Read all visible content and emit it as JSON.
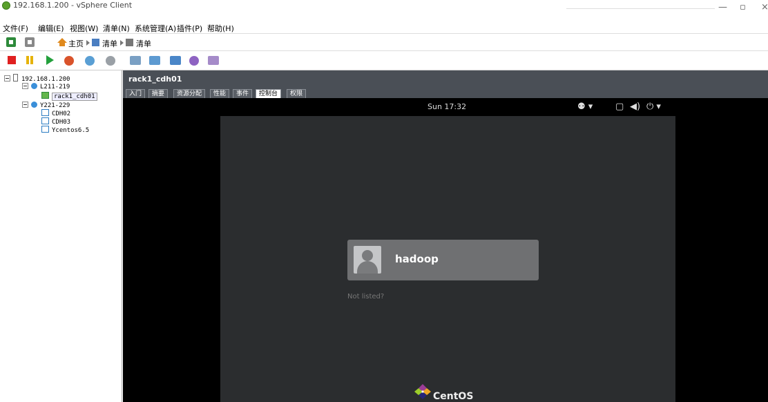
{
  "window": {
    "title": "192.168.1.200 - vSphere Client",
    "min": "—",
    "max": "▫",
    "close": "×"
  },
  "menu": [
    "文件(F)",
    "编辑(E)",
    "视图(W)",
    "清单(N)",
    "系统管理(A)",
    "插件(P)",
    "帮助(H)"
  ],
  "nav": {
    "home": "主页",
    "crumb1": "清单",
    "crumb2": "清单"
  },
  "tree": {
    "root": "192.168.1.200",
    "group1": "L211-219",
    "vm1": "rack1_cdh01",
    "group2": "Y221-229",
    "vm2": "CDH02",
    "vm3": "CDH03",
    "vm4": "Ycentos6.5"
  },
  "vm": {
    "title": "rack1_cdh01",
    "tabs": [
      "入门",
      "摘要",
      "资源分配",
      "性能",
      "事件",
      "控制台",
      "权限"
    ],
    "active_tab": "控制台"
  },
  "console": {
    "clock": "Sun 17:32",
    "user": "hadoop",
    "not_listed": "Not listed?",
    "brand": "CentOS",
    "icons": {
      "accessibility": "accessibility-icon",
      "window": "window-icon",
      "volume": "volume-icon",
      "power": "power-icon"
    }
  },
  "colors": {
    "header_bg": "#4a4f56",
    "guest_bg": "#2b2d2f",
    "card_bg": "#6f7072",
    "stop": "#e02020",
    "play": "#23a03c",
    "pause": "#e6b30a"
  }
}
